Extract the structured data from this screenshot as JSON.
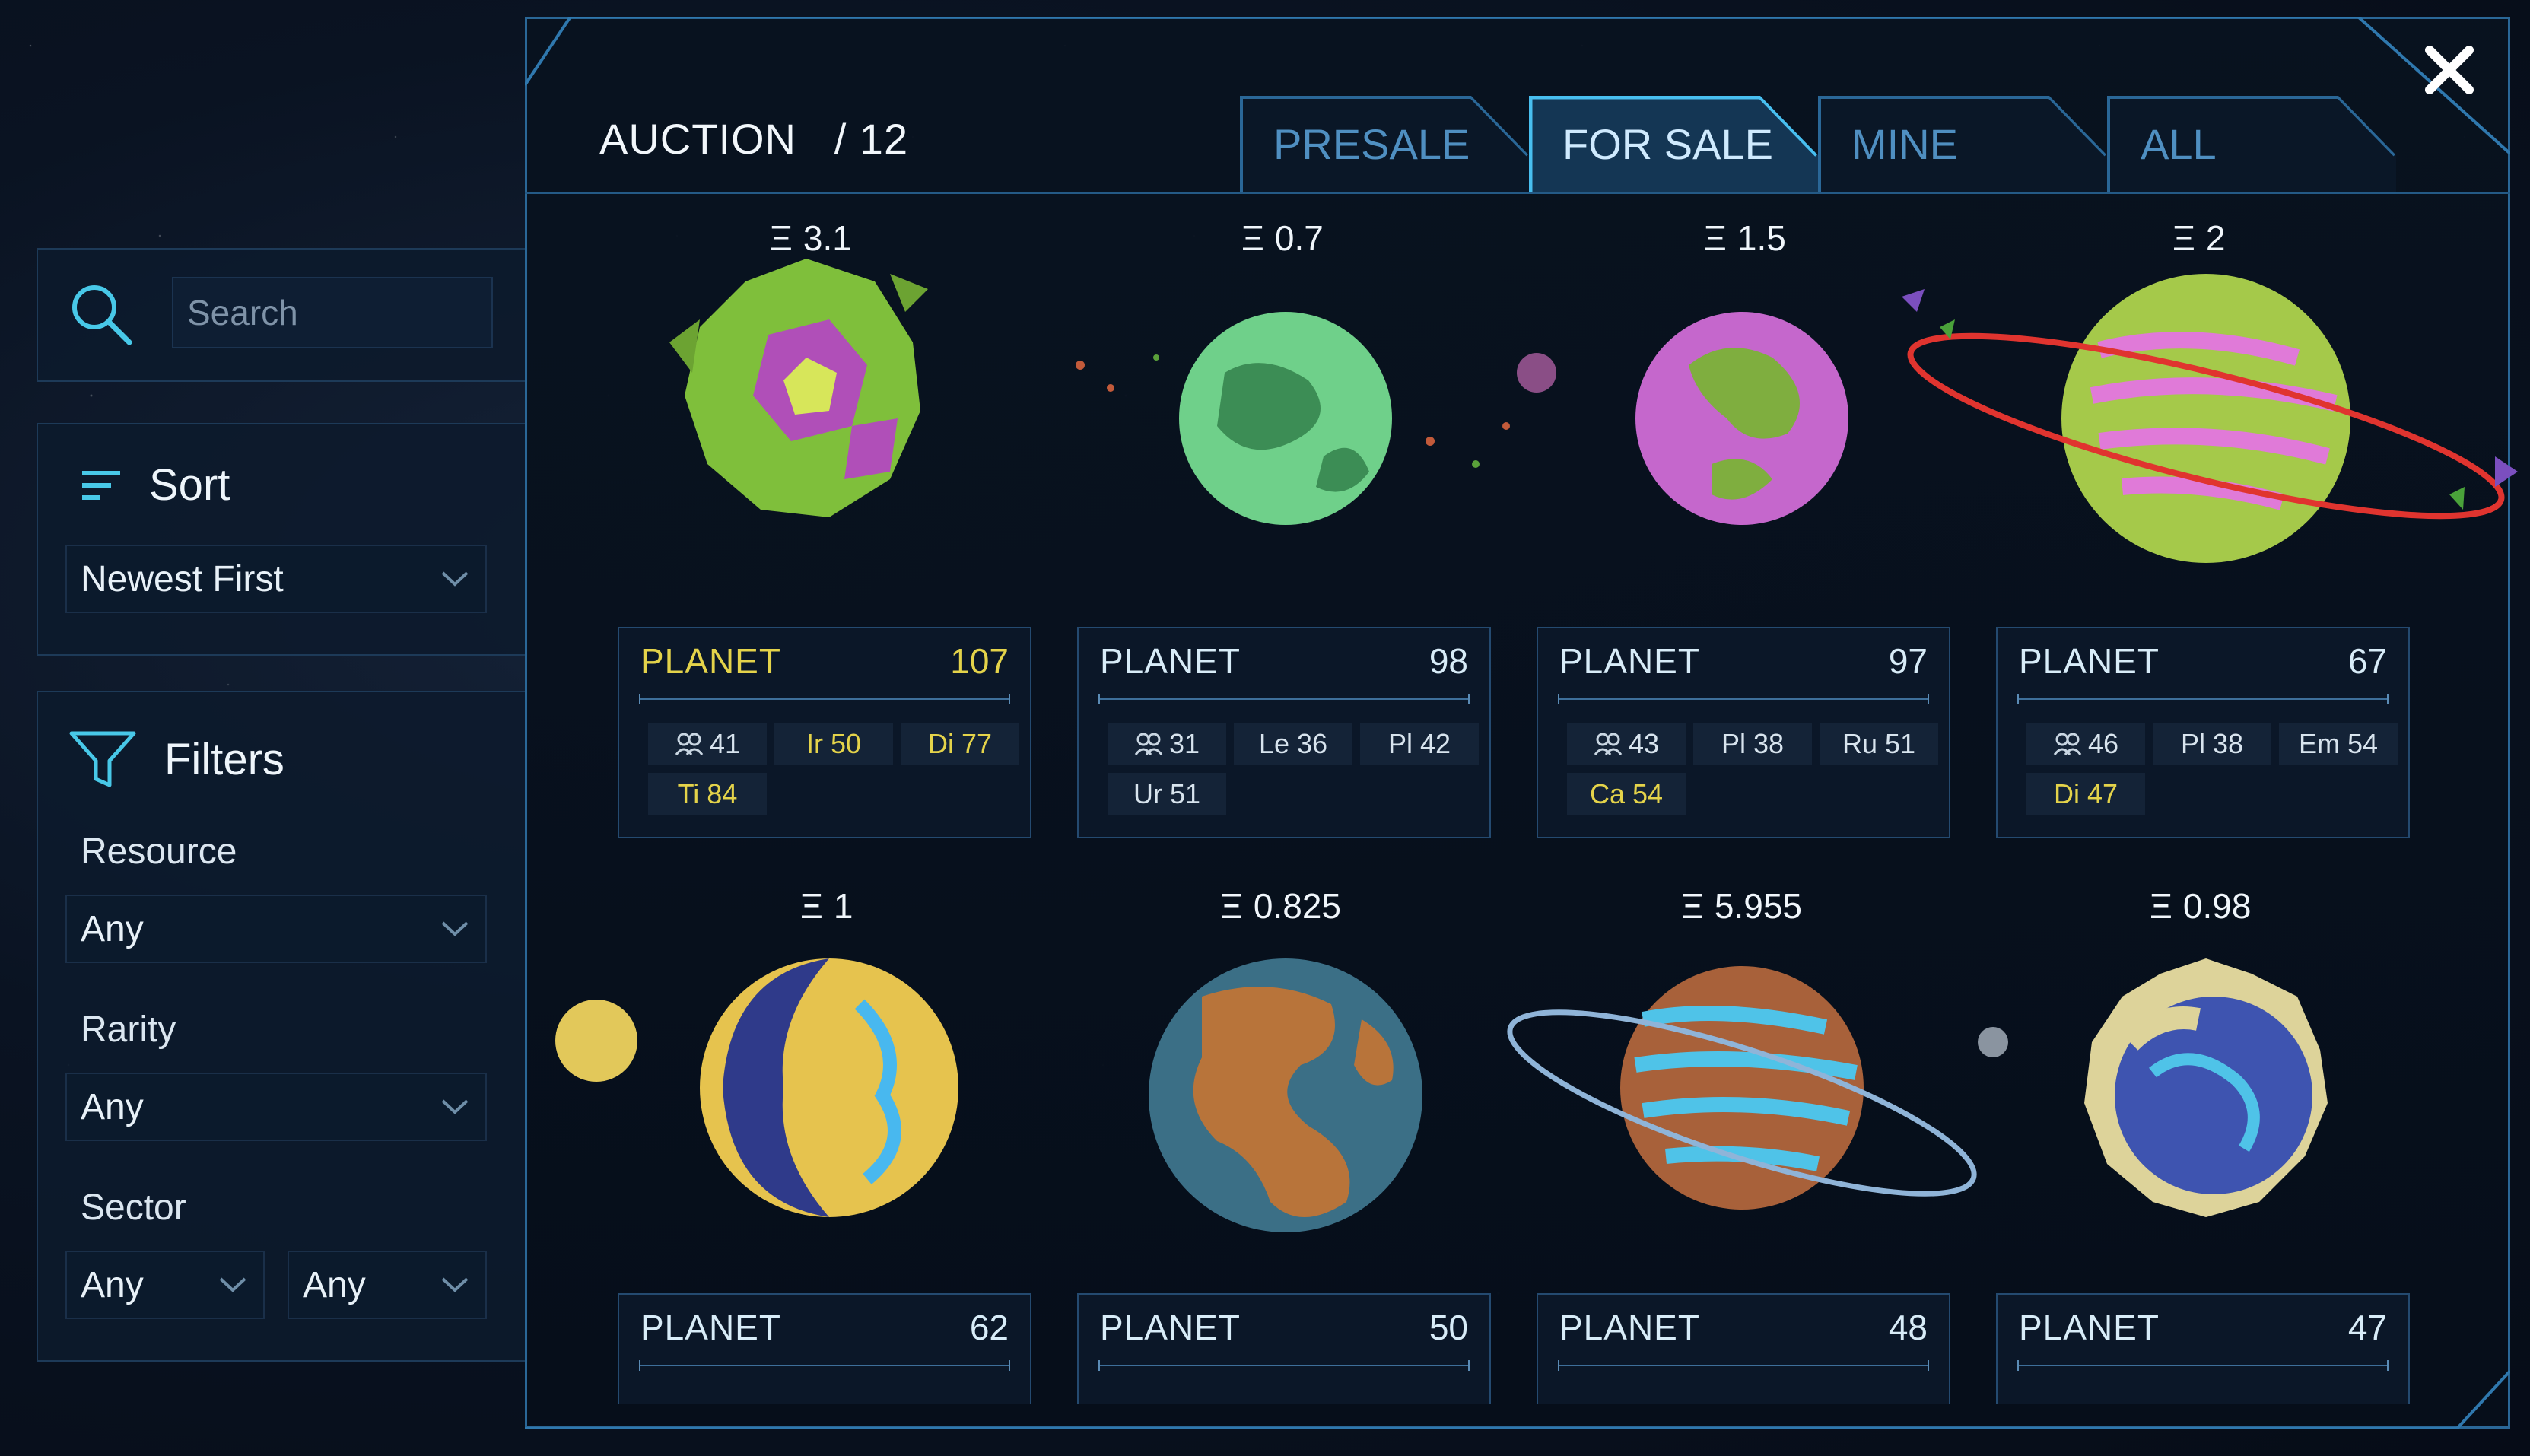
{
  "sidebar": {
    "search": {
      "placeholder": "Search"
    },
    "sort": {
      "title": "Sort",
      "selected": "Newest First"
    },
    "filters": {
      "title": "Filters",
      "resource": {
        "label": "Resource",
        "selected": "Any"
      },
      "rarity": {
        "label": "Rarity",
        "selected": "Any"
      },
      "sector": {
        "label": "Sector",
        "selected_a": "Any",
        "selected_b": "Any"
      }
    }
  },
  "header": {
    "title": "AUCTION",
    "count": "/ 12",
    "tabs": [
      {
        "label": "PRESALE",
        "active": false
      },
      {
        "label": "FOR SALE",
        "active": true
      },
      {
        "label": "MINE",
        "active": false
      },
      {
        "label": "ALL",
        "active": false
      }
    ],
    "close_icon": "close-icon"
  },
  "colors": {
    "accent": "#2a6797",
    "gold": "#e4d34a",
    "tab_active_bg": "#143654"
  },
  "planets": [
    {
      "price": "3.1",
      "title": "PLANET",
      "number": "107",
      "rarity": "gold",
      "population": "41",
      "chips": [
        {
          "text": "Ir 50",
          "gold": true
        },
        {
          "text": "Di 77",
          "gold": true
        },
        {
          "text": "Ti 84",
          "gold": true
        }
      ]
    },
    {
      "price": "0.7",
      "title": "PLANET",
      "number": "98",
      "rarity": "normal",
      "population": "31",
      "chips": [
        {
          "text": "Le 36",
          "gold": false
        },
        {
          "text": "Pl 42",
          "gold": false
        },
        {
          "text": "Ur 51",
          "gold": false
        }
      ]
    },
    {
      "price": "1.5",
      "title": "PLANET",
      "number": "97",
      "rarity": "normal",
      "population": "43",
      "chips": [
        {
          "text": "Pl 38",
          "gold": false
        },
        {
          "text": "Ru 51",
          "gold": false
        },
        {
          "text": "Ca 54",
          "gold": true
        }
      ]
    },
    {
      "price": "2",
      "title": "PLANET",
      "number": "67",
      "rarity": "normal",
      "population": "46",
      "chips": [
        {
          "text": "Pl 38",
          "gold": false
        },
        {
          "text": "Em 54",
          "gold": false
        },
        {
          "text": "Di 47",
          "gold": true
        }
      ]
    },
    {
      "price": "1",
      "title": "PLANET",
      "number": "62"
    },
    {
      "price": "0.825",
      "title": "PLANET",
      "number": "50"
    },
    {
      "price": "5.955",
      "title": "PLANET",
      "number": "48"
    },
    {
      "price": "0.98",
      "title": "PLANET",
      "number": "47"
    }
  ]
}
